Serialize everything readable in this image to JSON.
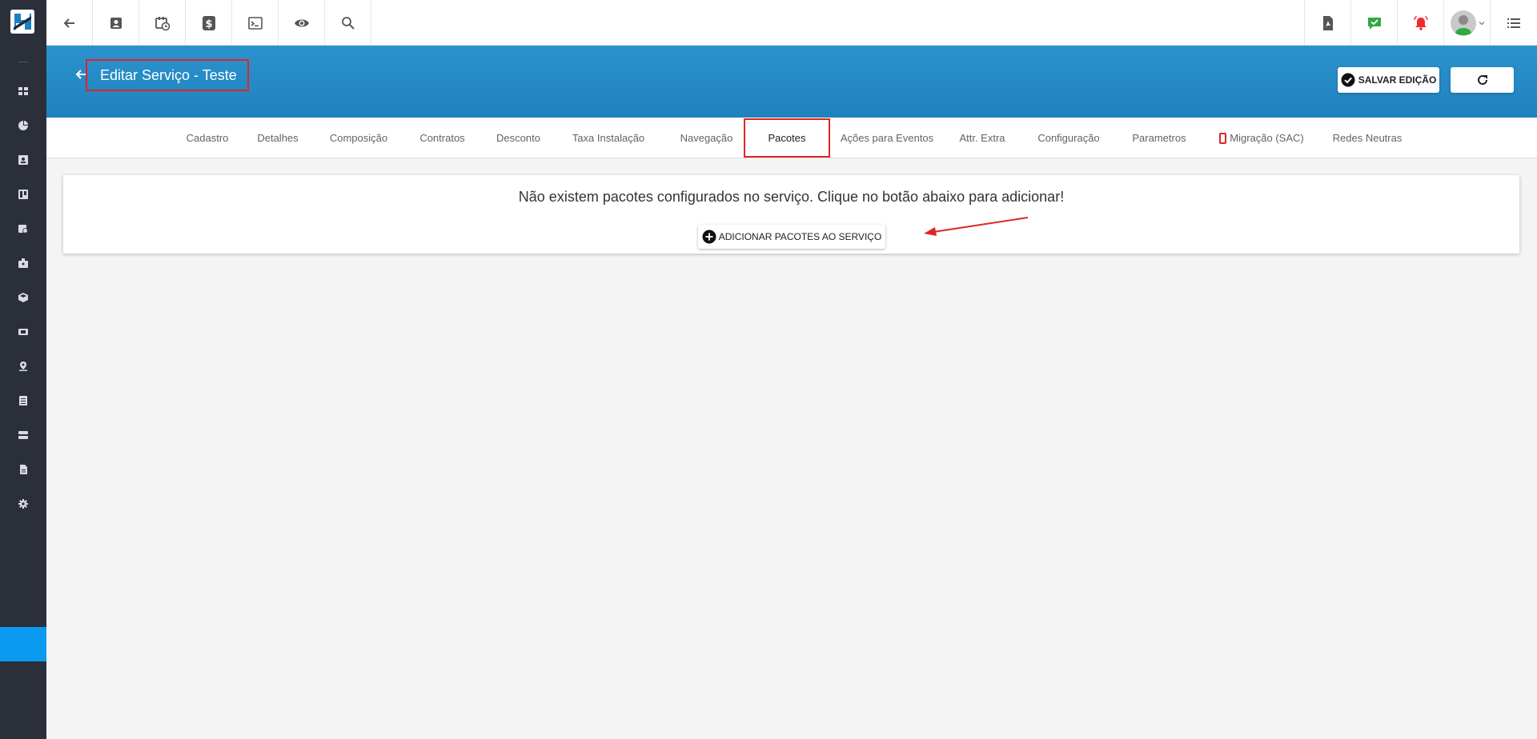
{
  "header": {
    "title": "Editar Serviço - Teste",
    "save_label": "SALVAR EDIÇÃO"
  },
  "tabs": [
    {
      "label": "Cadastro"
    },
    {
      "label": "Detalhes"
    },
    {
      "label": "Composição"
    },
    {
      "label": "Contratos"
    },
    {
      "label": "Desconto"
    },
    {
      "label": "Taxa Instalação"
    },
    {
      "label": "Navegação"
    },
    {
      "label": "Pacotes",
      "active": true
    },
    {
      "label": "Ações para Eventos"
    },
    {
      "label": "Attr. Extra"
    },
    {
      "label": "Configuração"
    },
    {
      "label": "Parametros"
    },
    {
      "label": "Migração (SAC)"
    },
    {
      "label": "Redes Neutras"
    }
  ],
  "content": {
    "empty_message": "Não existem pacotes configurados no serviço. Clique no botão abaixo para adicionar!",
    "add_button_label": "ADICIONAR PACOTES AO SERVIÇO"
  },
  "toolbar": {
    "icons": [
      "back-icon",
      "contact-card-icon",
      "calendar-clock-icon",
      "dollar-icon",
      "terminal-icon",
      "eye-icon",
      "search-icon",
      "pdf-icon",
      "chat-check-icon",
      "alarm-bell-icon",
      "user-avatar",
      "list-menu-icon"
    ]
  },
  "colors": {
    "header_blue": "#2189c6",
    "sidebar_dark": "#2b2f3a",
    "sidebar_active": "#0a9bf0",
    "highlight_red": "#e02424",
    "chat_green": "#2eaa3f",
    "alarm_red": "#ef2b2b"
  }
}
